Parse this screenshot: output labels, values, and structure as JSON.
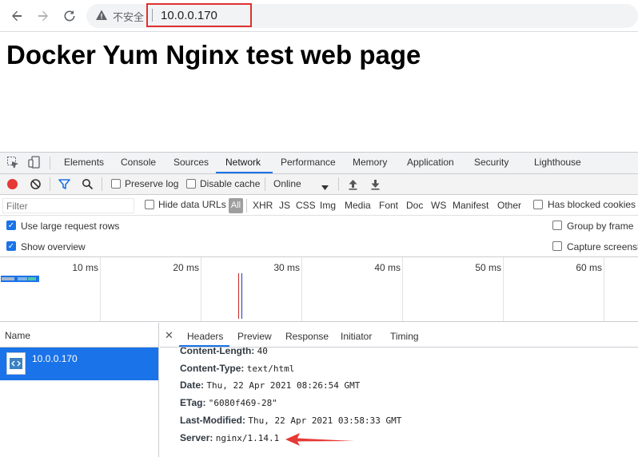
{
  "browser": {
    "security_text": "不安全",
    "url": "10.0.0.170"
  },
  "page": {
    "heading": "Docker Yum Nginx test web page"
  },
  "devtools": {
    "tabs": [
      "Elements",
      "Console",
      "Sources",
      "Network",
      "Performance",
      "Memory",
      "Application",
      "Security",
      "Lighthouse"
    ],
    "active_tab": "Network",
    "toolbar": {
      "preserve_log": "Preserve log",
      "disable_cache": "Disable cache",
      "throttle": "Online"
    },
    "filter": {
      "placeholder": "Filter",
      "hide_data_urls": "Hide data URLs",
      "types": [
        "All",
        "XHR",
        "JS",
        "CSS",
        "Img",
        "Media",
        "Font",
        "Doc",
        "WS",
        "Manifest",
        "Other"
      ],
      "has_blocked_cookies": "Has blocked cookies"
    },
    "options": {
      "large_rows": "Use large request rows",
      "group_by_frame": "Group by frame",
      "show_overview": "Show overview",
      "capture_screenshots": "Capture screensh"
    },
    "timeline_ticks": [
      "10 ms",
      "20 ms",
      "30 ms",
      "40 ms",
      "50 ms",
      "60 ms"
    ],
    "requests": {
      "column_name": "Name",
      "rows": [
        "10.0.0.170"
      ]
    },
    "detail_tabs": [
      "Headers",
      "Preview",
      "Response",
      "Initiator",
      "Timing"
    ],
    "headers": [
      {
        "key": "Content-Length:",
        "value": "40"
      },
      {
        "key": "Content-Type:",
        "value": "text/html"
      },
      {
        "key": "Date:",
        "value": "Thu, 22 Apr 2021 08:26:54 GMT"
      },
      {
        "key": "ETag:",
        "value": "\"6080f469-28\""
      },
      {
        "key": "Last-Modified:",
        "value": "Thu, 22 Apr 2021 03:58:33 GMT"
      },
      {
        "key": "Server:",
        "value": "nginx/1.14.1"
      }
    ]
  },
  "colors": {
    "accent": "#1a73e8",
    "highlight_box": "#e03030",
    "arrow": "#e53935"
  }
}
